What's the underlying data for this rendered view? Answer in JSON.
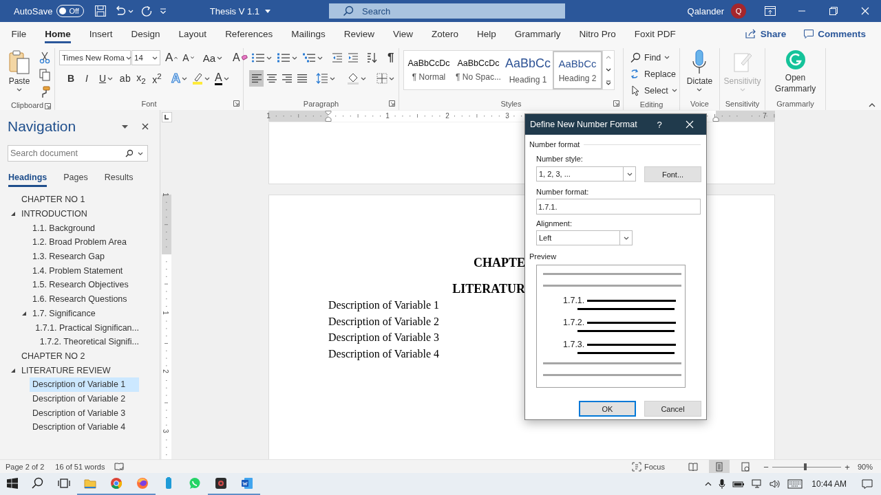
{
  "title_bar": {
    "autosave_label": "AutoSave",
    "autosave_on": false,
    "autosave_state": "Off",
    "document_title": "Thesis V 1.1",
    "search_placeholder": "Search",
    "user_name": "Qalander",
    "avatar_initial": "Q"
  },
  "menu_tabs": [
    {
      "label": "File",
      "selected": false
    },
    {
      "label": "Home",
      "selected": true
    },
    {
      "label": "Insert",
      "selected": false
    },
    {
      "label": "Design",
      "selected": false
    },
    {
      "label": "Layout",
      "selected": false
    },
    {
      "label": "References",
      "selected": false
    },
    {
      "label": "Mailings",
      "selected": false
    },
    {
      "label": "Review",
      "selected": false
    },
    {
      "label": "View",
      "selected": false
    },
    {
      "label": "Zotero",
      "selected": false
    },
    {
      "label": "Help",
      "selected": false
    },
    {
      "label": "Grammarly",
      "selected": false
    },
    {
      "label": "Nitro Pro",
      "selected": false
    },
    {
      "label": "Foxit PDF",
      "selected": false
    }
  ],
  "share_button": "Share",
  "comments_button": "Comments",
  "ribbon": {
    "clipboard": {
      "paste_label": "Paste",
      "group_label": "Clipboard"
    },
    "font": {
      "font_name": "Times New Roma",
      "font_size": "14",
      "grow_font": "A",
      "shrink_font": "A",
      "change_case": "Aa",
      "clear_formatting": "A",
      "format_buttons": [
        "B",
        "I",
        "U",
        "ab",
        "x$_{2}$",
        "x$^{2}$"
      ],
      "text_effects": "A",
      "font_color": "A",
      "group_label": "Font"
    },
    "paragraph": {
      "show_marks": "¶",
      "align_buttons": [
        {
          "kind": "left",
          "selected": true
        },
        {
          "kind": "center",
          "selected": false
        },
        {
          "kind": "right",
          "selected": false
        },
        {
          "kind": "justify",
          "selected": false
        }
      ],
      "group_label": "Paragraph"
    },
    "styles": {
      "items": [
        {
          "kind": "normal",
          "preview": "AaBbCcDc",
          "name": "¶ Normal",
          "selected": false
        },
        {
          "kind": "nospacing",
          "preview": "AaBbCcDc",
          "name": "¶ No Spac...",
          "selected": false
        },
        {
          "kind": "heading1",
          "preview": "AaBbCc",
          "name": "Heading 1",
          "selected": false
        },
        {
          "kind": "heading2",
          "preview": "AaBbCc",
          "name": "Heading 2",
          "selected": true
        }
      ],
      "group_label": "Styles"
    },
    "editing": {
      "items": [
        {
          "kind": "find",
          "label": "Find"
        },
        {
          "kind": "replace",
          "label": "Replace"
        },
        {
          "kind": "select",
          "label": "Select"
        }
      ],
      "group_label": "Editing"
    },
    "voice": {
      "button": "Dictate",
      "group_label": "Voice"
    },
    "sensitivity": {
      "button": "Sensitivity",
      "disabled": true,
      "group_label": "Sensitivity"
    },
    "grammarly": {
      "button": "Open Grammarly",
      "group_label": "Grammarly"
    }
  },
  "navigation": {
    "title": "Navigation",
    "search_placeholder": "Search document",
    "tabs": [
      {
        "label": "Headings",
        "selected": true
      },
      {
        "label": "Pages",
        "selected": false
      },
      {
        "label": "Results",
        "selected": false
      }
    ],
    "headings": [
      {
        "label": "CHAPTER NO 1",
        "selected": false
      },
      {
        "label": "INTRODUCTION",
        "expanded": true,
        "selected": false,
        "children": [
          {
            "label": "1.1. Background",
            "selected": false
          },
          {
            "label": "1.2. Broad Problem Area",
            "selected": false
          },
          {
            "label": "1.3. Research Gap",
            "selected": false
          },
          {
            "label": "1.4. Problem Statement",
            "selected": false
          },
          {
            "label": "1.5. Research Objectives",
            "selected": false
          },
          {
            "label": "1.6. Research Questions",
            "selected": false
          },
          {
            "label": "1.7. Significance",
            "expanded": true,
            "selected": false,
            "children": [
              {
                "label": "1.7.1. Practical Significan...",
                "selected": false
              },
              {
                "label": "1.7.2. Theoretical Signifi...",
                "selected": false
              }
            ]
          }
        ]
      },
      {
        "label": "CHAPTER NO 2",
        "selected": false
      },
      {
        "label": "LITERATURE REVIEW",
        "expanded": true,
        "selected": false,
        "children": [
          {
            "label": "Description of Variable 1",
            "selected": true
          },
          {
            "label": "Description of Variable 2",
            "selected": false
          },
          {
            "label": "Description of Variable 3",
            "selected": false
          },
          {
            "label": "Description of Variable 4",
            "selected": false
          }
        ]
      }
    ]
  },
  "rulers": {
    "horizontal_labels": [
      "1",
      "1",
      "2",
      "3",
      "7"
    ],
    "vertical_labels": [
      "1",
      "1",
      "2",
      "3"
    ]
  },
  "document": {
    "headings": [
      "CHAPTE",
      "LITERATUR"
    ],
    "paragraphs": [
      "Description of Variable 1",
      "Description of Variable 2",
      "Description of Variable 3",
      "Description of Variable 4"
    ]
  },
  "dialog": {
    "title": "Define New Number Format",
    "help": "?",
    "group_label": "Number format",
    "number_style_label": "Number style:",
    "number_style_value": "1, 2, 3, ...",
    "font_button": "Font...",
    "number_format_label": "Number format:",
    "number_format_value": "1.7.1.",
    "alignment_label": "Alignment:",
    "alignment_value": "Left",
    "preview_label": "Preview",
    "preview_items": [
      "1.7.1.",
      "1.7.2.",
      "1.7.3."
    ],
    "buttons": [
      {
        "kind": "default",
        "label": "OK"
      },
      {
        "kind": "normal",
        "label": "Cancel"
      }
    ]
  },
  "status_bar": {
    "page": "Page 2 of 2",
    "words": "16 of 51 words",
    "focus": "Focus",
    "views": [
      {
        "kind": "read",
        "selected": false
      },
      {
        "kind": "print",
        "selected": true
      },
      {
        "kind": "web",
        "selected": false
      }
    ],
    "zoom_out": "−",
    "zoom_slider": {
      "level": 0.48
    },
    "zoom_in": "+",
    "zoom_percent": "90%"
  },
  "taskbar": {
    "apps": [
      {
        "kind": "folder",
        "running": true
      },
      {
        "kind": "round",
        "running": true
      },
      {
        "kind": "globe",
        "running": true
      },
      {
        "kind": "cylinder",
        "running": false
      },
      {
        "kind": "chat",
        "running": false
      },
      {
        "kind": "lens",
        "running": true
      },
      {
        "kind": "document",
        "running": true
      }
    ],
    "time": "10:44 AM"
  }
}
